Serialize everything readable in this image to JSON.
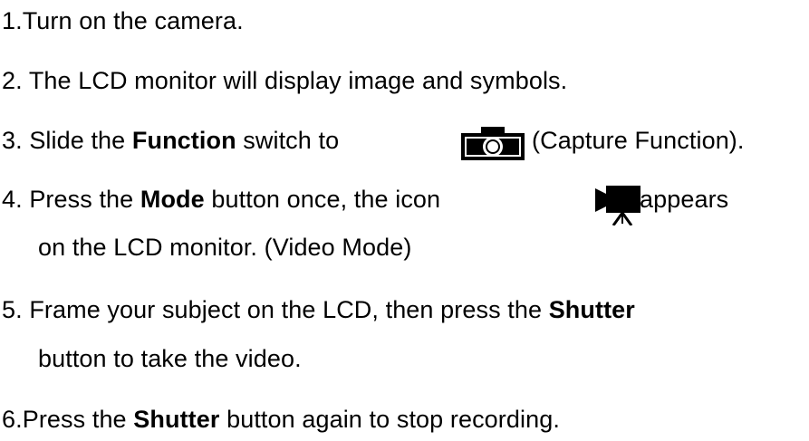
{
  "steps": [
    {
      "num": "1.",
      "text": "Turn on the camera."
    },
    {
      "num": "2.",
      "text": " The LCD monitor will display image and symbols."
    },
    {
      "num": "3.",
      "pre": " Slide the ",
      "bold": "Function",
      "post": " switch to",
      "icon": "camera-icon",
      "after_icon": "(Capture Function)."
    },
    {
      "num": "4.",
      "pre": " Press the ",
      "bold": "Mode",
      "post": " button once, the icon",
      "icon": "movie-camera-icon",
      "after_icon": "appears",
      "continuation": "on the LCD monitor. (Video Mode)"
    },
    {
      "num": "5.",
      "pre": " Frame your subject on the LCD, then press the ",
      "bold": "Shutter",
      "continuation": "button to take the video."
    },
    {
      "num": "6.",
      "pre": "Press the ",
      "bold": "Shutter",
      "post": " button again to stop recording."
    }
  ]
}
